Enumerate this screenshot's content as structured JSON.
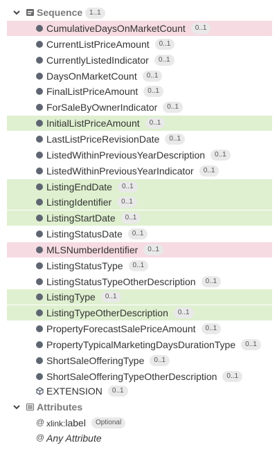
{
  "sequence": {
    "label": "Sequence",
    "badge": "1..1"
  },
  "elements": [
    {
      "name": "CumulativeDaysOnMarketCount",
      "card": "0..1",
      "highlight": "pink"
    },
    {
      "name": "CurrentListPriceAmount",
      "card": "0..1",
      "highlight": ""
    },
    {
      "name": "CurrentlyListedIndicator",
      "card": "0..1",
      "highlight": ""
    },
    {
      "name": "DaysOnMarketCount",
      "card": "0..1",
      "highlight": ""
    },
    {
      "name": "FinalListPriceAmount",
      "card": "0..1",
      "highlight": ""
    },
    {
      "name": "ForSaleByOwnerIndicator",
      "card": "0..1",
      "highlight": ""
    },
    {
      "name": "InitialListPriceAmount",
      "card": "0..1",
      "highlight": "green"
    },
    {
      "name": "LastListPriceRevisionDate",
      "card": "0..1",
      "highlight": ""
    },
    {
      "name": "ListedWithinPreviousYearDescription",
      "card": "0..1",
      "highlight": ""
    },
    {
      "name": "ListedWithinPreviousYearIndicator",
      "card": "0..1",
      "highlight": ""
    },
    {
      "name": "ListingEndDate",
      "card": "0..1",
      "highlight": "green"
    },
    {
      "name": "ListingIdentifier",
      "card": "0..1",
      "highlight": "green"
    },
    {
      "name": "ListingStartDate",
      "card": "0..1",
      "highlight": "green"
    },
    {
      "name": "ListingStatusDate",
      "card": "0..1",
      "highlight": ""
    },
    {
      "name": "MLSNumberIdentifier",
      "card": "0..1",
      "highlight": "pink"
    },
    {
      "name": "ListingStatusType",
      "card": "0..1",
      "highlight": ""
    },
    {
      "name": "ListingStatusTypeOtherDescription",
      "card": "0..1",
      "highlight": ""
    },
    {
      "name": "ListingType",
      "card": "0..1",
      "highlight": "green"
    },
    {
      "name": "ListingTypeOtherDescription",
      "card": "0..1",
      "highlight": "green"
    },
    {
      "name": "PropertyForecastSalePriceAmount",
      "card": "0..1",
      "highlight": ""
    },
    {
      "name": "PropertyTypicalMarketingDaysDurationType",
      "card": "0..1",
      "highlight": ""
    },
    {
      "name": "ShortSaleOfferingType",
      "card": "0..1",
      "highlight": ""
    },
    {
      "name": "ShortSaleOfferingTypeOtherDescription",
      "card": "0..1",
      "highlight": ""
    }
  ],
  "extension": {
    "name": "EXTENSION",
    "card": "0..1"
  },
  "attributes": {
    "label": "Attributes",
    "xlink": {
      "prefix": "xlink:",
      "name": "label",
      "badge": "Optional"
    },
    "any": "Any Attribute"
  },
  "colors": {
    "green_highlight": "#dff0d0",
    "pink_highlight": "#f6dbe3",
    "dot": "#5f6671",
    "header_text": "#7a7a7a"
  }
}
